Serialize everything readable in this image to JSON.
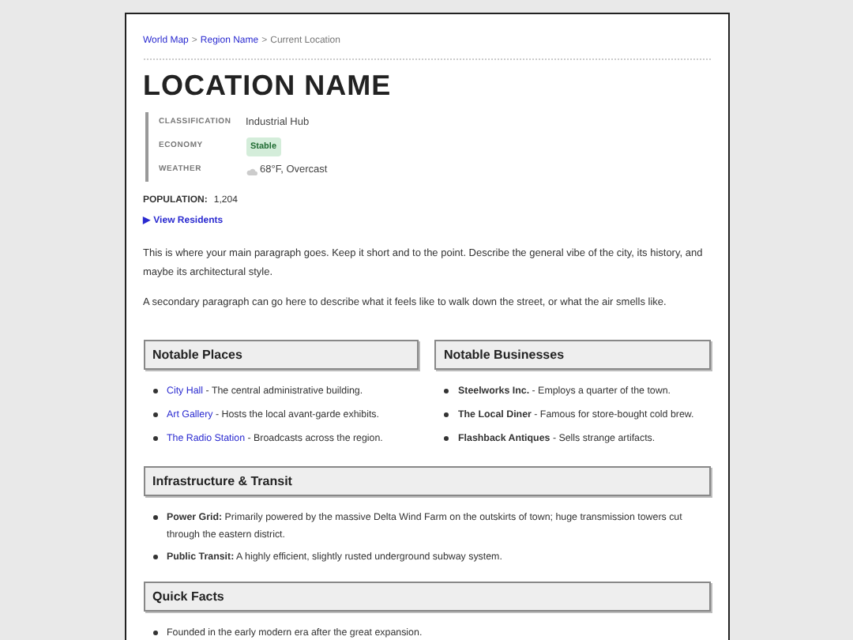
{
  "breadcrumb": {
    "links": [
      "World Map",
      "Region Name"
    ],
    "separator": ">",
    "current": "Current Location"
  },
  "title": "LOCATION NAME",
  "info": [
    {
      "kind": "text",
      "label": "CLASSIFICATION",
      "value": "Industrial Hub"
    },
    {
      "kind": "badge",
      "label": "ECONOMY",
      "value": "Stable",
      "color": "#d4edda"
    },
    {
      "kind": "weather",
      "label": "WEATHER",
      "value": "68°F, Overcast"
    }
  ],
  "population": {
    "label": "POPULATION:",
    "value": "1,204"
  },
  "residents_toggle": {
    "label": "▶ View Residents"
  },
  "paragraphs": [
    "This is where your main paragraph goes. Keep it short and to the point. Describe the general vibe of the city, its history, and maybe its architectural style.",
    "A secondary paragraph can go here to describe what it feels like to walk down the street, or what the air smells like."
  ],
  "notable_places": {
    "title": "Notable Places",
    "items": [
      {
        "name": "City Hall",
        "desc": "- The central administrative building."
      },
      {
        "name": "Art Gallery",
        "desc": "- Hosts the local avant-garde exhibits."
      },
      {
        "name": "The Radio Station",
        "desc": "- Broadcasts across the region."
      }
    ]
  },
  "notable_businesses": {
    "title": "Notable Businesses",
    "items": [
      "**Steelworks Inc.** - Employs a quarter of the town.",
      "**The Local Diner** - Famous for store-bought cold brew.",
      "**Flashback Antiques** - Sells strange artifacts."
    ]
  },
  "infrastructure": {
    "title": "Infrastructure & Transit",
    "items": [
      "**Power Grid:** Primarily powered by the massive Delta Wind Farm on the outskirts of town; huge transmission towers cut through the eastern district.",
      "**Public Transit:** A highly efficient, slightly rusted underground subway system."
    ]
  },
  "quick_facts": {
    "title": "Quick Facts",
    "items": [
      "Founded in the early modern era after the great expansion."
    ]
  }
}
